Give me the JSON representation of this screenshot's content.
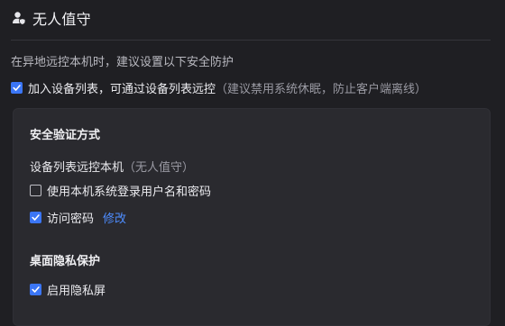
{
  "header": {
    "title": "无人值守",
    "icon": "user-shield-icon"
  },
  "hint": "在异地远控本机时，建议设置以下安全防护",
  "add_device": {
    "checked": true,
    "label": "加入设备列表，可通过设备列表远控",
    "note": "（建议禁用系统休眠，防止客户端离线）"
  },
  "security": {
    "title": "安全验证方式",
    "subtitle": "设备列表远控本机",
    "subtitle_note": "（无人值守）",
    "options": [
      {
        "label": "使用本机系统登录用户名和密码",
        "checked": false
      },
      {
        "label": "访问密码",
        "checked": true,
        "link": "修改"
      }
    ]
  },
  "privacy": {
    "title": "桌面隐私保护",
    "options": [
      {
        "label": "启用隐私屏",
        "checked": true
      }
    ]
  },
  "colors": {
    "accent": "#3b76f6",
    "link": "#4e8dff",
    "background": "#1f1f23",
    "panel": "#2a2a2f"
  }
}
